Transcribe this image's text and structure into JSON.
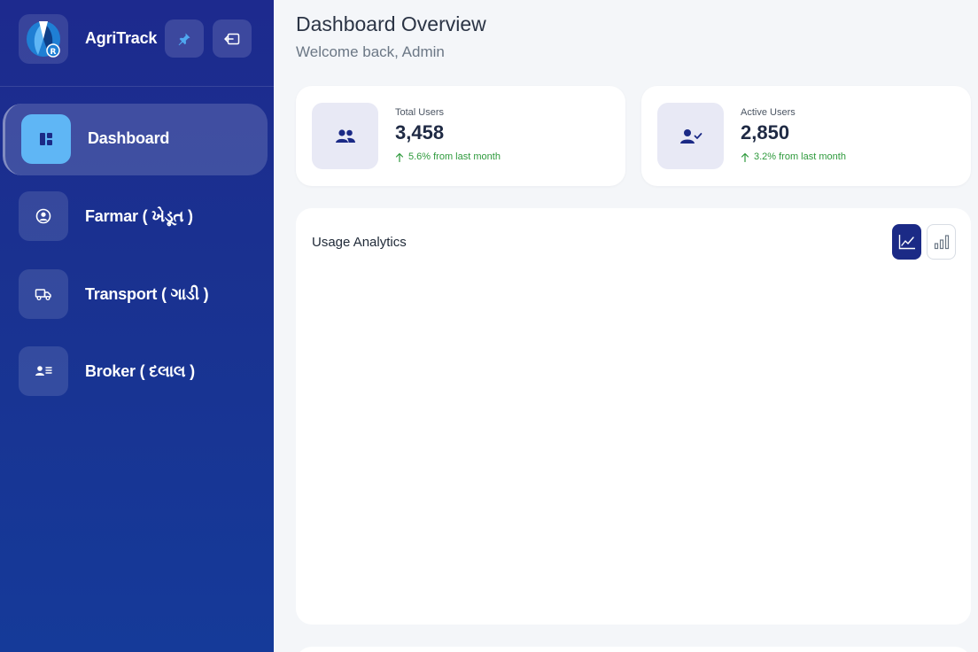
{
  "brand": {
    "name": "AgriTrack",
    "logo_icon": "agritrack-logo"
  },
  "header_buttons": {
    "pin_icon": "pin-icon",
    "collapse_icon": "collapse-sidebar-icon"
  },
  "sidebar": {
    "items": [
      {
        "label": "Dashboard",
        "icon": "dashboard-icon",
        "active": true
      },
      {
        "label": "Farmar ( ખેડૂત )",
        "icon": "user-circle-icon",
        "active": false
      },
      {
        "label": "Transport ( ગાડી )",
        "icon": "truck-icon",
        "active": false
      },
      {
        "label": "Broker ( દલાલ )",
        "icon": "id-list-icon",
        "active": false
      }
    ]
  },
  "main": {
    "title": "Dashboard Overview",
    "subtitle": "Welcome back, Admin"
  },
  "stats": [
    {
      "label": "Total Users",
      "value": "3,458",
      "trend": "5.6% from last month",
      "icon": "users-icon"
    },
    {
      "label": "Active Users",
      "value": "2,850",
      "trend": "3.2% from last month",
      "icon": "user-check-icon"
    }
  ],
  "analytics": {
    "title": "Usage Analytics",
    "toggle_line_icon": "line-chart-icon",
    "toggle_bar_icon": "bar-chart-icon",
    "active_view": "line"
  },
  "colors": {
    "sidebar_top": "#1d2a8e",
    "sidebar_bottom": "#153a99",
    "active_icon_bg": "#5fb6f5",
    "accent": "#1b2a86",
    "trend_positive": "#2e9a3c"
  }
}
